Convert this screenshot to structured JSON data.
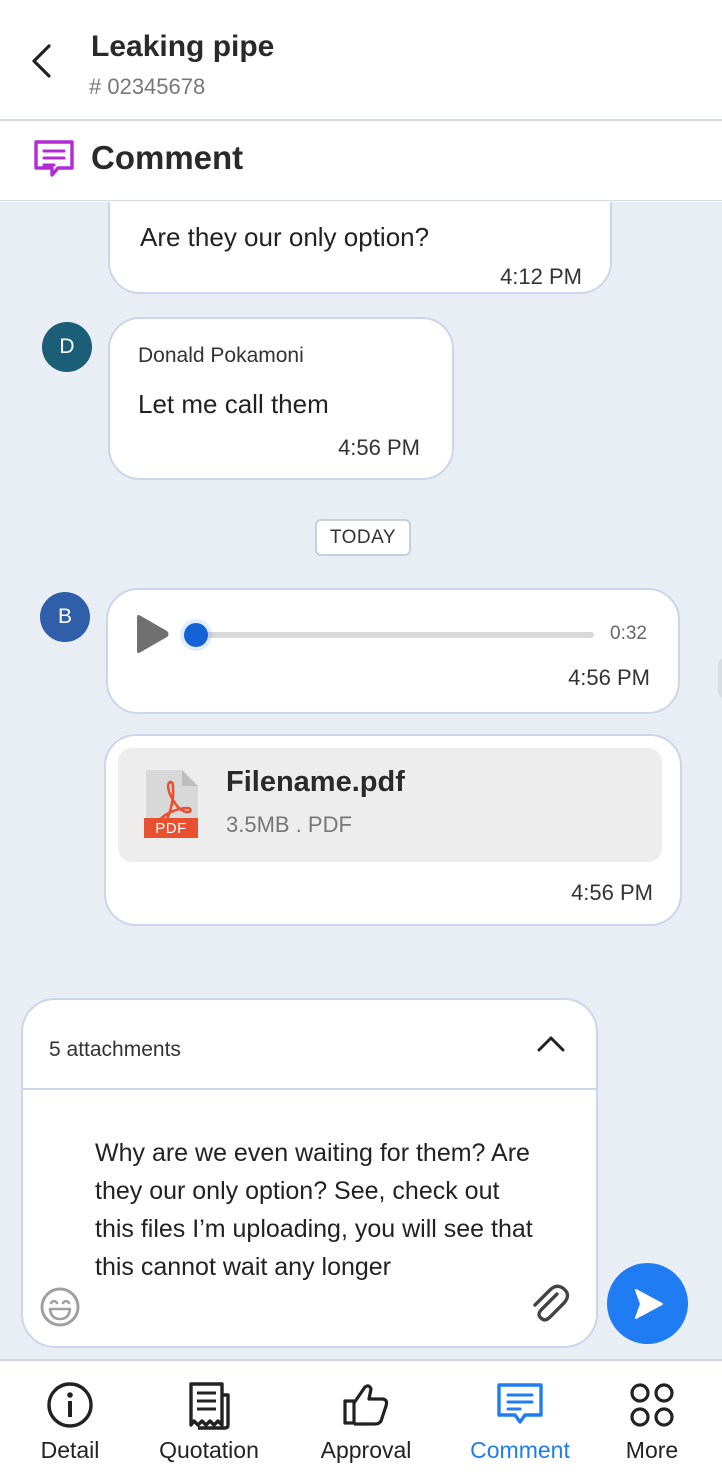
{
  "header": {
    "title": "Leaking pipe",
    "ticket_number": "# 02345678"
  },
  "section": {
    "title": "Comment"
  },
  "messages": [
    {
      "text": "Are they our only option?",
      "time": "4:12 PM"
    },
    {
      "avatar_initial": "D",
      "sender": "Donald Pokamoni",
      "text": "Let me call them",
      "time": "4:56 PM"
    },
    {
      "avatar_initial": "B",
      "duration": "0:32",
      "progress": 0.0,
      "time": "4:56 PM"
    },
    {
      "file_name": "Filename.pdf",
      "file_meta": "3.5MB .  PDF",
      "file_badge": "PDF",
      "time": "4:56 PM"
    }
  ],
  "date_divider": "TODAY",
  "composer": {
    "attachments_label": "5 attachments",
    "message": "Why are we even waiting for them? Are they our only option? See, check out this files I’m uploading, you will see that this cannot wait any longer"
  },
  "nav": [
    {
      "label": "Detail",
      "icon": "info-icon"
    },
    {
      "label": "Quotation",
      "icon": "receipt-icon"
    },
    {
      "label": "Approval",
      "icon": "thumbs-up-icon"
    },
    {
      "label": "Comment",
      "icon": "comment-icon",
      "active": true
    },
    {
      "label": "More",
      "icon": "grid-icon"
    }
  ],
  "colors": {
    "accent": "#1f7cf2",
    "section_icon": "#b42bd6",
    "chat_bg": "#e9edf4",
    "pdf_red": "#e8502f"
  }
}
